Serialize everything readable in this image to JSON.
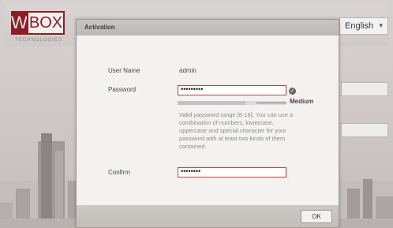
{
  "logo": {
    "mark": "W",
    "word": "BOX",
    "subtitle": "TECHNOLOGIES"
  },
  "language": {
    "selected": "English"
  },
  "dialog": {
    "title": "Activation",
    "user_name_label": "User Name",
    "user_name_value": "admin",
    "password_label": "Password",
    "password_value": "•••••••••",
    "strength_label": "Medium",
    "strength_level": 0.62,
    "hint": "Valid password range [8-16]. You can use a combination of numbers, lowercase, uppercase and special character for your password with at least two kinds of them contained.",
    "confirm_label": "Confirm",
    "confirm_value": "••••••••",
    "ok_label": "OK"
  },
  "colors": {
    "brand": "#8c1d22",
    "dialog_bg": "#f3f2f0",
    "title_bar": "#c3bfbc"
  },
  "icons": {
    "check": "check-icon",
    "dropdown": "chevron-down-icon"
  }
}
